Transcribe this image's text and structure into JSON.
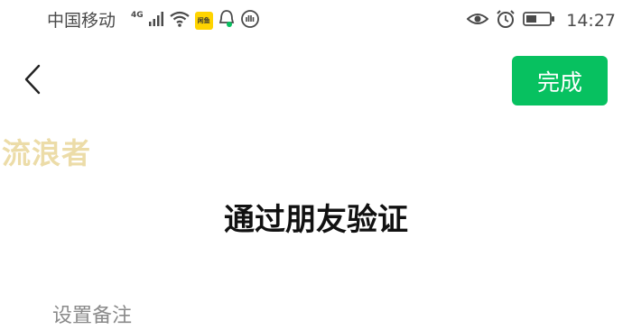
{
  "status_bar": {
    "carrier": "中国移动",
    "network_type": "4G",
    "app_badge_text": "闲鱼",
    "time": "14:27",
    "icons_left": [
      "signal-icon",
      "wifi-icon",
      "app-badge-icon",
      "notification-icon",
      "app-icon"
    ],
    "icons_right": [
      "eye-icon",
      "alarm-icon",
      "battery-icon"
    ]
  },
  "nav": {
    "done_label": "完成"
  },
  "watermark": "流浪者",
  "page": {
    "title": "通过朋友验证",
    "remark_label": "设置备注"
  },
  "colors": {
    "accent": "#07c160",
    "watermark": "#ecdca8"
  }
}
